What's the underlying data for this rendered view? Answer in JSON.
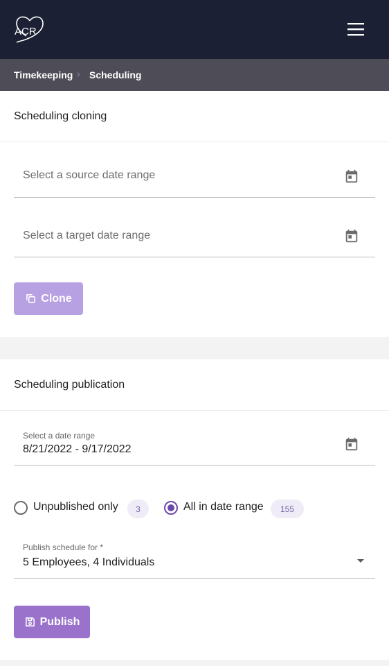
{
  "header": {
    "logo_text": "ACR",
    "menu_icon": "hamburger-menu-icon"
  },
  "breadcrumb": {
    "items": [
      "Timekeeping",
      "Scheduling"
    ],
    "separator": "›",
    "separator_icon": "chevron-right-icon"
  },
  "cloning": {
    "title": "Scheduling cloning",
    "source_placeholder": "Select a source date range",
    "target_placeholder": "Select a target date range",
    "calendar_icon": "calendar-icon",
    "clone_label": "Clone",
    "clone_icon": "copy-icon",
    "clone_disabled": true
  },
  "publication": {
    "title": "Scheduling publication",
    "date_range_label": "Select a date range",
    "date_range_value": "8/21/2022 - 9/17/2022",
    "radio_options": [
      {
        "label": "Unpublished only",
        "count": "3",
        "selected": false
      },
      {
        "label": "All in date range",
        "count": "155",
        "selected": true
      }
    ],
    "publish_for_label": "Publish schedule for *",
    "publish_for_value": "5 Employees, 4 Individuals",
    "publish_label": "Publish",
    "publish_icon": "save-icon"
  },
  "colors": {
    "topbar": "#1b2034",
    "breadcrumb_bar": "#4e4d57",
    "primary": "#9a72cc",
    "primary_disabled": "#b7a1e3",
    "radio_selected": "#6a49a8",
    "badge_bg": "#efecf7"
  }
}
